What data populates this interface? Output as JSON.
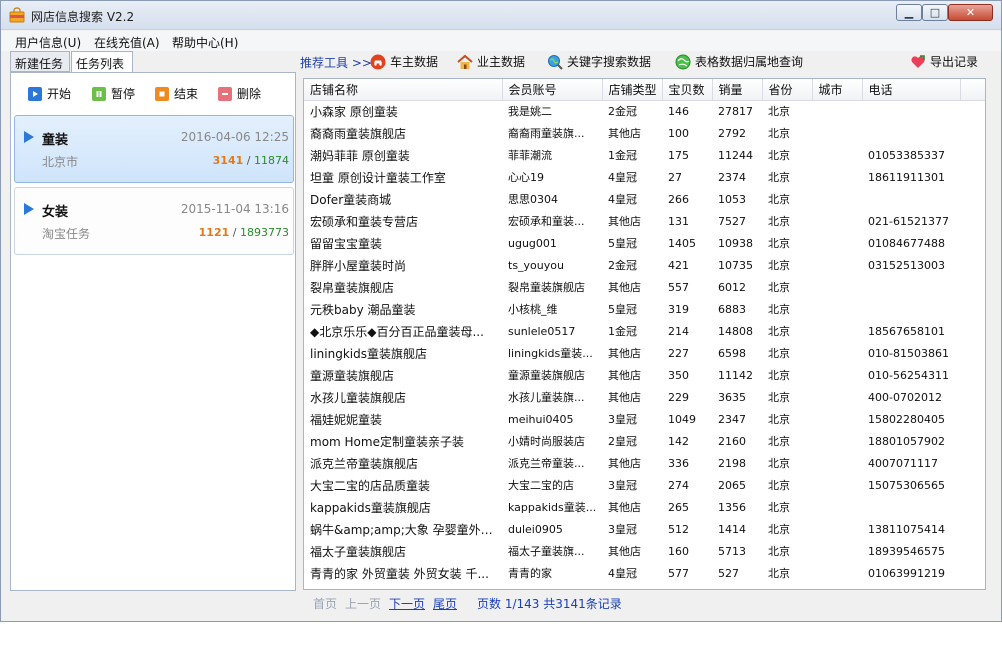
{
  "window": {
    "title": "网店信息搜索 V2.2"
  },
  "menu": [
    {
      "label": "用户信息(U)"
    },
    {
      "label": "在线充值(A)"
    },
    {
      "label": "帮助中心(H)"
    }
  ],
  "left_tabs": [
    {
      "label": "新建任务"
    },
    {
      "label": "任务列表"
    }
  ],
  "task_toolbar": {
    "start": "开始",
    "pause": "暂停",
    "end": "结束",
    "delete": "删除"
  },
  "tasks": [
    {
      "name": "童装",
      "date": "2016-04-06 12:25",
      "location": "北京市",
      "done": "3141",
      "sep": "/",
      "total": "11874"
    },
    {
      "name": "女装",
      "date": "2015-11-04 13:16",
      "location": "淘宝任务",
      "done": "1121",
      "sep": "/",
      "total": "1893773"
    }
  ],
  "toolbar": {
    "recommend": "推荐工具 >>",
    "car_owner": "车主数据",
    "home_owner": "业主数据",
    "keyword_search": "关键字搜索数据",
    "table_lookup": "表格数据归属地查询",
    "export": "导出记录"
  },
  "table": {
    "columns": [
      "店铺名称",
      "会员账号",
      "店铺类型",
      "宝贝数",
      "销量",
      "省份",
      "城市",
      "电话",
      ""
    ],
    "rows": [
      [
        "小森家 原创童装",
        "我是姚二",
        "2金冠",
        "146",
        "27817",
        "北京",
        "",
        "",
        ""
      ],
      [
        "裔裔雨童装旗舰店",
        "裔裔雨童装旗...",
        "其他店",
        "100",
        "2792",
        "北京",
        "",
        "",
        ""
      ],
      [
        "潮妈菲菲 原创童装",
        "菲菲潮流",
        "1金冠",
        "175",
        "11244",
        "北京",
        "",
        "01053385337",
        ""
      ],
      [
        "坦童 原创设计童装工作室",
        "心心19",
        "4皇冠",
        "27",
        "2374",
        "北京",
        "",
        "18611911301",
        ""
      ],
      [
        "Dofer童装商城",
        "思思0304",
        "4皇冠",
        "266",
        "1053",
        "北京",
        "",
        "",
        ""
      ],
      [
        "宏硕承和童装专营店",
        "宏硕承和童装...",
        "其他店",
        "131",
        "7527",
        "北京",
        "",
        "021-61521377",
        ""
      ],
      [
        "留留宝宝童装",
        "ugug001",
        "5皇冠",
        "1405",
        "10938",
        "北京",
        "",
        "01084677488",
        ""
      ],
      [
        "胖胖小屋童装时尚",
        "ts_youyou",
        "2金冠",
        "421",
        "10735",
        "北京",
        "",
        "03152513003",
        ""
      ],
      [
        "裂帛童装旗舰店",
        "裂帛童装旗舰店",
        "其他店",
        "557",
        "6012",
        "北京",
        "",
        "",
        ""
      ],
      [
        "元秩baby 潮品童装",
        "小核桃_维",
        "5皇冠",
        "319",
        "6883",
        "北京",
        "",
        "",
        ""
      ],
      [
        "◆北京乐乐◆百分百正品童装母...",
        "sunlele0517",
        "1金冠",
        "214",
        "14808",
        "北京",
        "",
        "18567658101",
        ""
      ],
      [
        "liningkids童装旗舰店",
        "liningkids童装...",
        "其他店",
        "227",
        "6598",
        "北京",
        "",
        "010-81503861",
        ""
      ],
      [
        "童源童装旗舰店",
        "童源童装旗舰店",
        "其他店",
        "350",
        "11142",
        "北京",
        "",
        "010-56254311",
        ""
      ],
      [
        "水孩儿童装旗舰店",
        "水孩儿童装旗...",
        "其他店",
        "229",
        "3635",
        "北京",
        "",
        "400-0702012",
        ""
      ],
      [
        "福娃妮妮童装",
        "meihui0405",
        "3皇冠",
        "1049",
        "2347",
        "北京",
        "",
        "15802280405",
        ""
      ],
      [
        "mom Home定制童装亲子装",
        "小婧时尚服装店",
        "2皇冠",
        "142",
        "2160",
        "北京",
        "",
        "18801057902",
        ""
      ],
      [
        "派克兰帝童装旗舰店",
        "派克兰帝童装...",
        "其他店",
        "336",
        "2198",
        "北京",
        "",
        "4007071117",
        ""
      ],
      [
        "大宝二宝的店品质童装",
        "大宝二宝的店",
        "3皇冠",
        "274",
        "2065",
        "北京",
        "",
        "15075306565",
        ""
      ],
      [
        "kappakids童装旗舰店",
        "kappakids童装...",
        "其他店",
        "265",
        "1356",
        "北京",
        "",
        "",
        ""
      ],
      [
        "蜗牛&amp;amp;大象 孕婴童外贸...",
        "dulei0905",
        "3皇冠",
        "512",
        "1414",
        "北京",
        "",
        "13811075414",
        ""
      ],
      [
        "福太子童装旗舰店",
        "福太子童装旗...",
        "其他店",
        "160",
        "5713",
        "北京",
        "",
        "18939546575",
        ""
      ],
      [
        "青青的家 外贸童装 外贸女装 千...",
        "青青的家",
        "4皇冠",
        "577",
        "527",
        "北京",
        "",
        "01063991219",
        ""
      ]
    ]
  },
  "pager": {
    "first": "首页",
    "prev": "上一页",
    "next": "下一页",
    "last": "尾页",
    "info": "页数 1/143 共3141条记录"
  },
  "colors": {
    "accent": "#2b78d8",
    "done_count": "#e07a1b",
    "total_count": "#2a8a2a",
    "link": "#1a3fb8"
  }
}
